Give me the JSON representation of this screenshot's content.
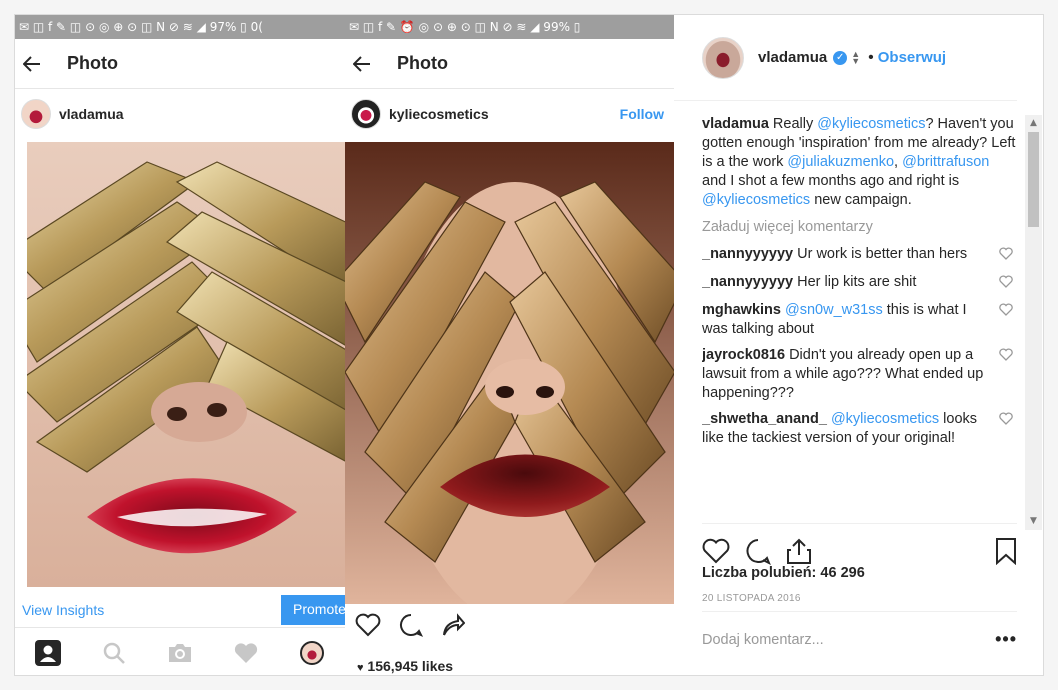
{
  "left_phone": {
    "status": "✉ ◫ f ✎ ◫ ⊙ ◎ ⊕ ⊙ ◫  N ⊘ ≋ ◢ 97% ▯ 0(",
    "title": "Photo",
    "username": "vladamua",
    "insights": "View Insights",
    "promote": "Promote"
  },
  "right_phone": {
    "status": "✉ ◫ f ✎ ⏰ ◎ ⊙ ⊕ ⊙ ◫  N ⊘ ≋ ◢ 99% ▯",
    "title": "Photo",
    "username": "kyliecosmetics",
    "follow": "Follow",
    "likes": "156,945 likes"
  },
  "sidebar": {
    "username": "vladamua",
    "separator": "•",
    "follow": "Obserwuj",
    "caption": {
      "user": "vladamua",
      "parts": [
        {
          "t": " Really "
        },
        {
          "m": "@kyliecosmetics"
        },
        {
          "t": "? Haven't you gotten enough 'inspiration' from me already? Left is a the work "
        },
        {
          "m": "@juliakuzmenko"
        },
        {
          "t": ", "
        },
        {
          "m": "@brittrafuson"
        },
        {
          "t": " and I shot a few months ago and right is "
        },
        {
          "m": "@kyliecosmetics"
        },
        {
          "t": " new campaign."
        }
      ]
    },
    "load_more": "Załaduj więcej komentarzy",
    "comments": [
      {
        "user": "_nannyyyyyy",
        "parts": [
          {
            "t": " Ur work is better than hers"
          }
        ]
      },
      {
        "user": "_nannyyyyyy",
        "parts": [
          {
            "t": " Her lip kits are shit"
          }
        ]
      },
      {
        "user": "mghawkins",
        "parts": [
          {
            "t": " "
          },
          {
            "m": "@sn0w_w31ss"
          },
          {
            "t": " this is what I was talking about"
          }
        ]
      },
      {
        "user": "jayrock0816",
        "parts": [
          {
            "t": " Didn't you already open up a lawsuit from a while ago??? What ended up happening???"
          }
        ]
      },
      {
        "user": "_shwetha_anand_",
        "parts": [
          {
            "t": " "
          },
          {
            "m": "@kyliecosmetics"
          },
          {
            "t": " looks like the tackiest version of your original!"
          }
        ]
      }
    ],
    "likes": "Liczba polubień: 46 296",
    "date": "20 LISTOPADA 2016",
    "add_comment_placeholder": "Dodaj komentarz...",
    "more": "•••"
  }
}
